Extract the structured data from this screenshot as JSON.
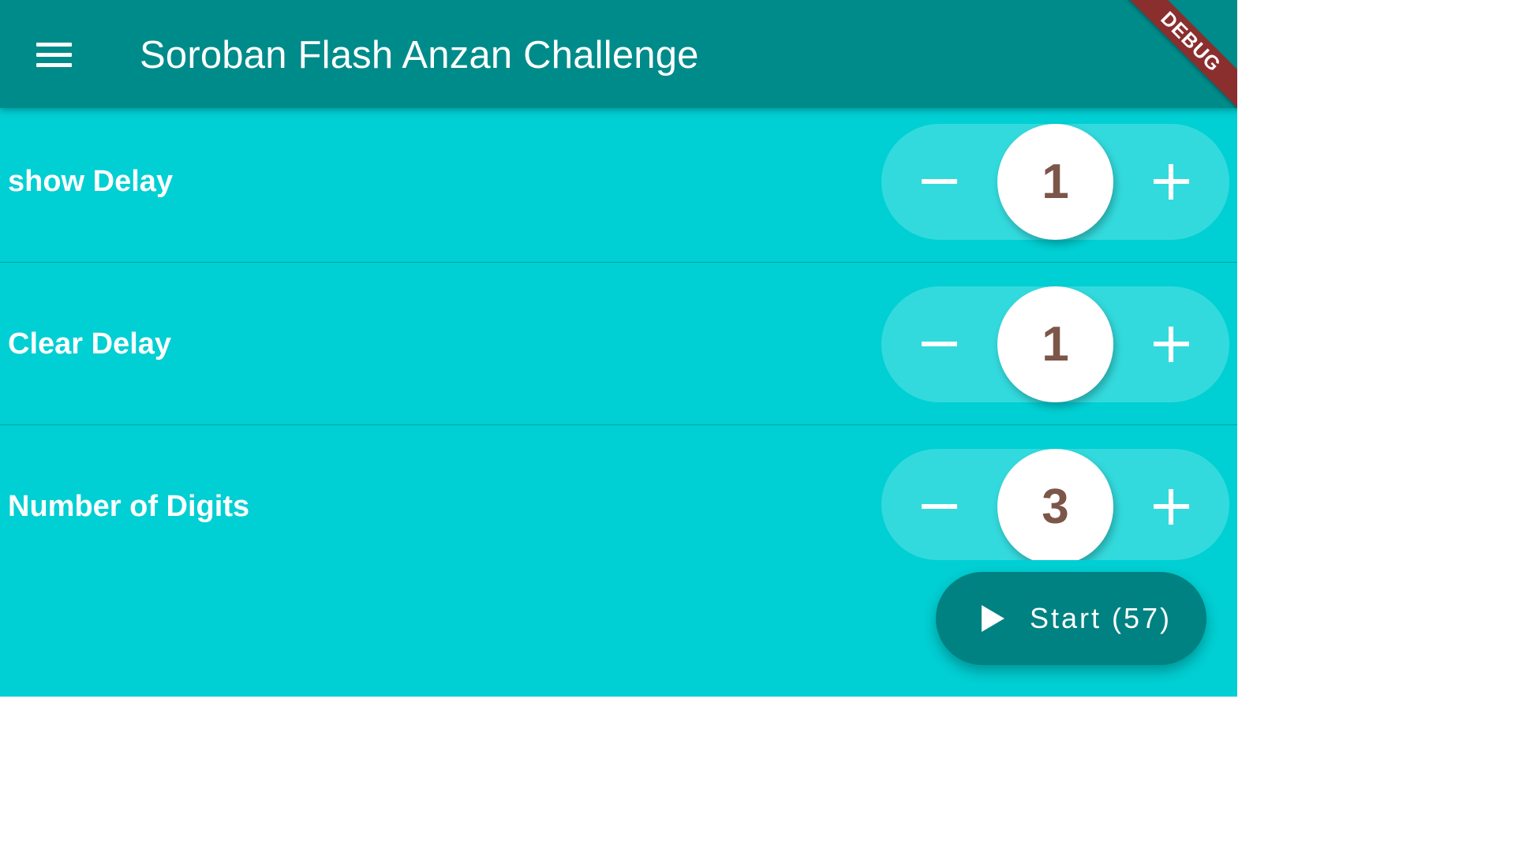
{
  "app": {
    "title": "Soroban Flash Anzan Challenge",
    "debug_banner": "DEBUG",
    "menu_icon": "hamburger-menu-icon"
  },
  "settings": [
    {
      "label": "show Delay",
      "value": "1",
      "decrement_icon": "minus-icon",
      "increment_icon": "plus-icon"
    },
    {
      "label": "Clear Delay",
      "value": "1",
      "decrement_icon": "minus-icon",
      "increment_icon": "plus-icon"
    },
    {
      "label": "Number of Digits",
      "value": "3",
      "decrement_icon": "minus-icon",
      "increment_icon": "plus-icon"
    }
  ],
  "start_button": {
    "label": "Start (57)",
    "icon": "play-icon"
  },
  "colors": {
    "appbar": "#008b8b",
    "background": "#00cfd3",
    "stepper_track": "#33dadd",
    "value_text": "#7b5649",
    "fab": "#008282",
    "debug_banner": "#8b2e2e"
  }
}
